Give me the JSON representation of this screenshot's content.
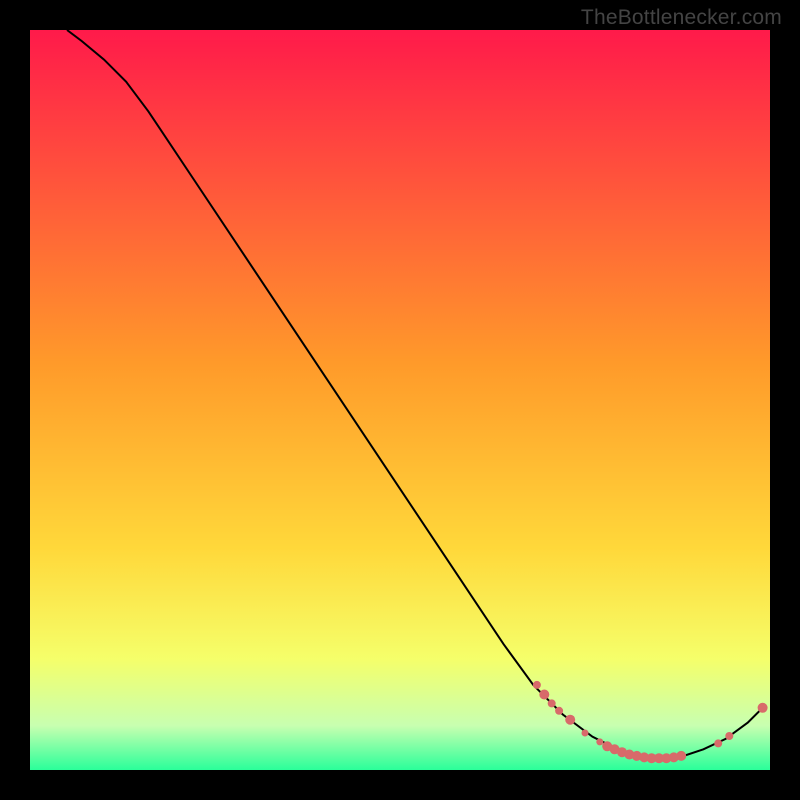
{
  "watermark": "TheBottlenecker.com",
  "colors": {
    "curve": "#000000",
    "marker_fill": "#d86a6a",
    "marker_stroke": "#b94e4e",
    "gradient_top": "#ff1a4a",
    "gradient_mid1": "#ff7a2a",
    "gradient_mid2": "#ffd83a",
    "gradient_mid3": "#f5ff6a",
    "gradient_mid4": "#c8ffb0",
    "gradient_bottom": "#2aff9a"
  },
  "chart_data": {
    "type": "line",
    "title": "",
    "xlabel": "",
    "ylabel": "",
    "xlim": [
      0,
      100
    ],
    "ylim": [
      0,
      100
    ],
    "grid": false,
    "legend": false,
    "curve": [
      {
        "x": 5,
        "y": 100
      },
      {
        "x": 7,
        "y": 98.5
      },
      {
        "x": 10,
        "y": 96
      },
      {
        "x": 13,
        "y": 93
      },
      {
        "x": 16,
        "y": 89
      },
      {
        "x": 22,
        "y": 80
      },
      {
        "x": 30,
        "y": 68
      },
      {
        "x": 40,
        "y": 53
      },
      {
        "x": 50,
        "y": 38
      },
      {
        "x": 58,
        "y": 26
      },
      {
        "x": 64,
        "y": 17
      },
      {
        "x": 68,
        "y": 11.5
      },
      {
        "x": 72,
        "y": 7.5
      },
      {
        "x": 76,
        "y": 4.5
      },
      {
        "x": 80,
        "y": 2.5
      },
      {
        "x": 84,
        "y": 1.6
      },
      {
        "x": 88,
        "y": 1.8
      },
      {
        "x": 91,
        "y": 2.8
      },
      {
        "x": 94,
        "y": 4.2
      },
      {
        "x": 97,
        "y": 6.4
      },
      {
        "x": 99,
        "y": 8.4
      }
    ],
    "markers": [
      {
        "x": 68.5,
        "y": 11.5,
        "r": 4
      },
      {
        "x": 69.5,
        "y": 10.2,
        "r": 5
      },
      {
        "x": 70.5,
        "y": 9.0,
        "r": 4
      },
      {
        "x": 71.5,
        "y": 8.0,
        "r": 4
      },
      {
        "x": 73.0,
        "y": 6.8,
        "r": 5
      },
      {
        "x": 75.0,
        "y": 5.0,
        "r": 3.5
      },
      {
        "x": 77.0,
        "y": 3.8,
        "r": 3.5
      },
      {
        "x": 78.0,
        "y": 3.2,
        "r": 5
      },
      {
        "x": 79.0,
        "y": 2.8,
        "r": 5
      },
      {
        "x": 80.0,
        "y": 2.4,
        "r": 5
      },
      {
        "x": 81.0,
        "y": 2.1,
        "r": 5
      },
      {
        "x": 82.0,
        "y": 1.9,
        "r": 5
      },
      {
        "x": 83.0,
        "y": 1.7,
        "r": 5
      },
      {
        "x": 84.0,
        "y": 1.6,
        "r": 5
      },
      {
        "x": 85.0,
        "y": 1.6,
        "r": 5
      },
      {
        "x": 86.0,
        "y": 1.6,
        "r": 5
      },
      {
        "x": 87.0,
        "y": 1.7,
        "r": 5
      },
      {
        "x": 88.0,
        "y": 1.9,
        "r": 5
      },
      {
        "x": 93.0,
        "y": 3.6,
        "r": 4
      },
      {
        "x": 94.5,
        "y": 4.6,
        "r": 4
      },
      {
        "x": 99.0,
        "y": 8.4,
        "r": 5
      }
    ]
  }
}
